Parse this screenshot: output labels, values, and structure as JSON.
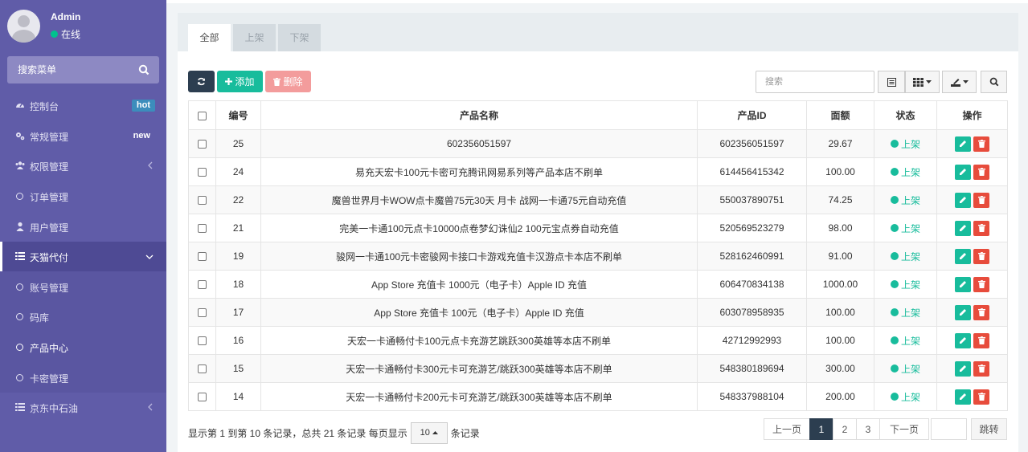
{
  "user": {
    "name": "Admin",
    "status": "在线"
  },
  "sidebar": {
    "search_placeholder": "搜索菜单",
    "items": [
      {
        "label": "控制台",
        "icon": "dashboard-icon",
        "badge": "hot"
      },
      {
        "label": "常规管理",
        "icon": "cogs-icon",
        "badge": "new"
      },
      {
        "label": "权限管理",
        "icon": "group-icon"
      },
      {
        "label": "订单管理",
        "icon": "circle-icon"
      },
      {
        "label": "用户管理",
        "icon": "user-icon"
      },
      {
        "label": "天猫代付",
        "icon": "list-icon"
      },
      {
        "label": "账号管理",
        "icon": "circle-icon"
      },
      {
        "label": "码库",
        "icon": "circle-icon"
      },
      {
        "label": "产品中心",
        "icon": "circle-icon"
      },
      {
        "label": "卡密管理",
        "icon": "circle-icon"
      },
      {
        "label": "京东中石油",
        "icon": "list-icon"
      }
    ]
  },
  "tabs": [
    "全部",
    "上架",
    "下架"
  ],
  "toolbar": {
    "add_label": "添加",
    "delete_label": "删除",
    "search_placeholder": "搜索"
  },
  "table": {
    "headers": [
      "编号",
      "产品名称",
      "产品ID",
      "面额",
      "状态",
      "操作"
    ],
    "rows": [
      {
        "id": "25",
        "name": "602356051597",
        "pid": "602356051597",
        "amount": "29.67",
        "status": "上架"
      },
      {
        "id": "24",
        "name": "易充天宏卡100元卡密可充腾讯网易系列等产品本店不刷单",
        "pid": "614456415342",
        "amount": "100.00",
        "status": "上架"
      },
      {
        "id": "22",
        "name": "魔兽世界月卡WOW点卡魔兽75元30天 月卡 战网一卡通75元自动充值",
        "pid": "550037890751",
        "amount": "74.25",
        "status": "上架"
      },
      {
        "id": "21",
        "name": "完美一卡通100元点卡10000点卷梦幻诛仙2 100元宝点券自动充值",
        "pid": "520569523279",
        "amount": "98.00",
        "status": "上架"
      },
      {
        "id": "19",
        "name": "骏网一卡通100元卡密骏网卡接口卡游戏充值卡汉游点卡本店不刷单",
        "pid": "528162460991",
        "amount": "91.00",
        "status": "上架"
      },
      {
        "id": "18",
        "name": "App Store 充值卡 1000元（电子卡）Apple ID 充值",
        "pid": "606470834138",
        "amount": "1000.00",
        "status": "上架"
      },
      {
        "id": "17",
        "name": "App Store 充值卡 100元（电子卡）Apple ID 充值",
        "pid": "603078958935",
        "amount": "100.00",
        "status": "上架"
      },
      {
        "id": "16",
        "name": "天宏一卡通畅付卡100元点卡充游艺跳跃300英雄等本店不刷单",
        "pid": "42712992993",
        "amount": "100.00",
        "status": "上架"
      },
      {
        "id": "15",
        "name": "天宏一卡通畅付卡300元卡可充游艺/跳跃300英雄等本店不刷单",
        "pid": "548380189694",
        "amount": "300.00",
        "status": "上架"
      },
      {
        "id": "14",
        "name": "天宏一卡通畅付卡200元卡可充游艺/跳跃300英雄等本店不刷单",
        "pid": "548337988104",
        "amount": "200.00",
        "status": "上架"
      }
    ]
  },
  "footer": {
    "info_prefix": "显示第 1 到第 10 条记录，总共 21 条记录 每页显示",
    "page_size": "10",
    "info_suffix": "条记录",
    "prev": "上一页",
    "pages": [
      "1",
      "2",
      "3"
    ],
    "next": "下一页",
    "jump": "跳转"
  },
  "colors": {
    "sidebar": "#605ca8",
    "accent": "#18bc9c",
    "danger": "#e74c3c",
    "dark": "#2c3e50"
  }
}
